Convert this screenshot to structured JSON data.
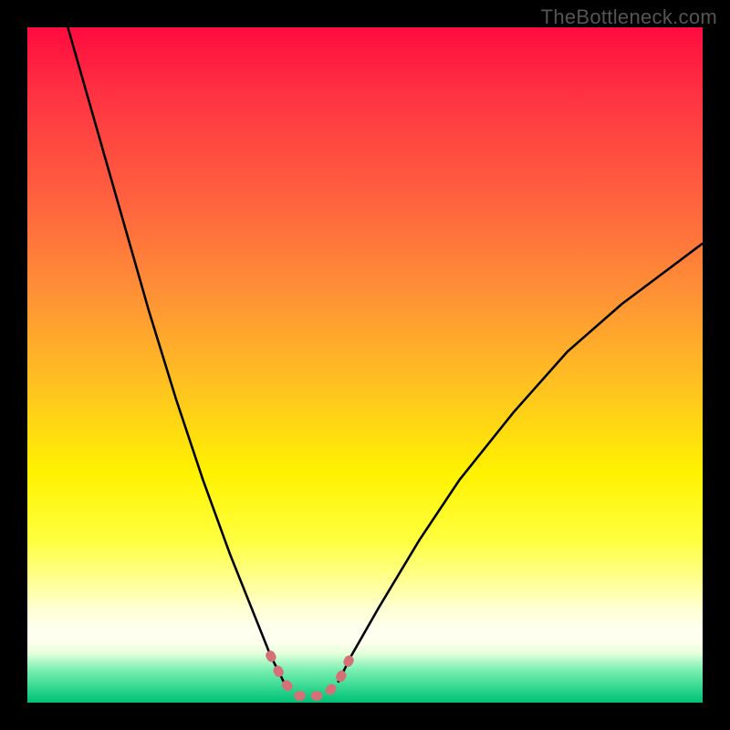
{
  "watermark": "TheBottleneck.com",
  "chart_data": {
    "type": "line",
    "title": "",
    "xlabel": "",
    "ylabel": "",
    "xlim": [
      0,
      100
    ],
    "ylim": [
      0,
      100
    ],
    "background": {
      "kind": "vertical-gradient",
      "stops": [
        {
          "pos": 0,
          "color": "#ff0b3f"
        },
        {
          "pos": 28,
          "color": "#ff6a3e"
        },
        {
          "pos": 55,
          "color": "#ffc91d"
        },
        {
          "pos": 76,
          "color": "#ffff40"
        },
        {
          "pos": 88,
          "color": "#ffffe0"
        },
        {
          "pos": 97,
          "color": "#4dff9a"
        },
        {
          "pos": 100,
          "color": "#00e589"
        }
      ]
    },
    "series": [
      {
        "name": "left-curve",
        "stroke": "#000000",
        "x": [
          6,
          10,
          14,
          18,
          22,
          26,
          30,
          34,
          36,
          38
        ],
        "y": [
          100,
          86,
          72,
          58,
          45,
          33,
          22,
          12,
          7,
          3
        ]
      },
      {
        "name": "right-curve",
        "stroke": "#000000",
        "x": [
          46,
          48,
          52,
          58,
          64,
          72,
          80,
          88,
          96,
          100
        ],
        "y": [
          3,
          7,
          14,
          24,
          33,
          43,
          52,
          59,
          65,
          68
        ]
      },
      {
        "name": "valley-highlight",
        "stroke": "#d67077",
        "stroke_width": 10,
        "x": [
          36,
          38,
          40,
          42,
          44,
          46,
          48
        ],
        "y": [
          7,
          3,
          1,
          1,
          1,
          3,
          7
        ]
      }
    ],
    "annotations": []
  }
}
